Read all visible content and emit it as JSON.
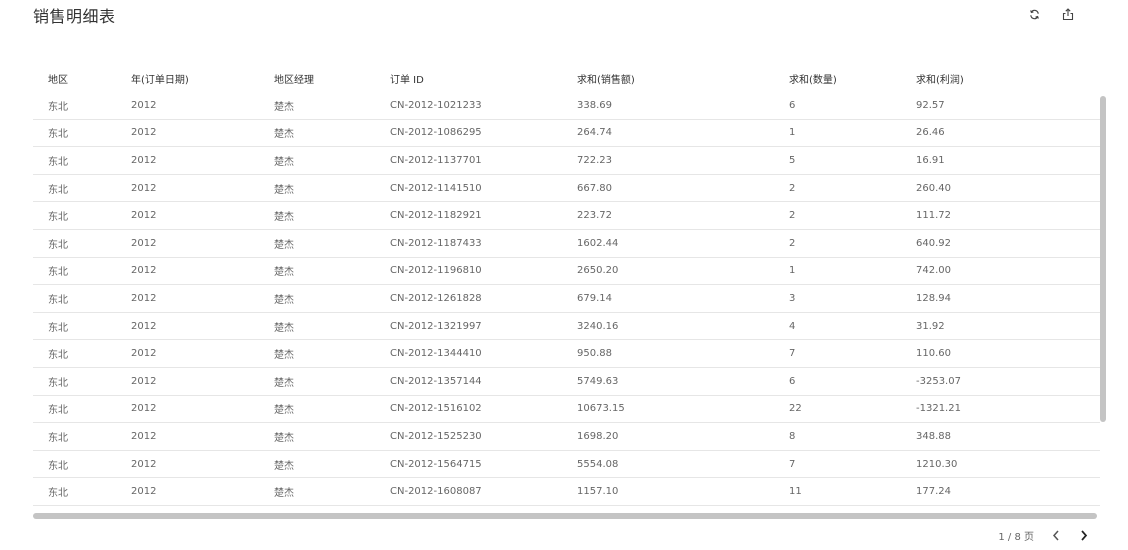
{
  "report": {
    "title": "销售明细表"
  },
  "toolbar": {
    "refresh_icon": "refresh-icon",
    "export_icon": "export-icon"
  },
  "table": {
    "columns": [
      "地区",
      "年(订单日期)",
      "地区经理",
      "订单 ID",
      "求和(销售额)",
      "求和(数量)",
      "求和(利润)"
    ],
    "rows": [
      [
        "东北",
        "2012",
        "楚杰",
        "CN-2012-1021233",
        "338.69",
        "6",
        "92.57"
      ],
      [
        "东北",
        "2012",
        "楚杰",
        "CN-2012-1086295",
        "264.74",
        "1",
        "26.46"
      ],
      [
        "东北",
        "2012",
        "楚杰",
        "CN-2012-1137701",
        "722.23",
        "5",
        "16.91"
      ],
      [
        "东北",
        "2012",
        "楚杰",
        "CN-2012-1141510",
        "667.80",
        "2",
        "260.40"
      ],
      [
        "东北",
        "2012",
        "楚杰",
        "CN-2012-1182921",
        "223.72",
        "2",
        "111.72"
      ],
      [
        "东北",
        "2012",
        "楚杰",
        "CN-2012-1187433",
        "1602.44",
        "2",
        "640.92"
      ],
      [
        "东北",
        "2012",
        "楚杰",
        "CN-2012-1196810",
        "2650.20",
        "1",
        "742.00"
      ],
      [
        "东北",
        "2012",
        "楚杰",
        "CN-2012-1261828",
        "679.14",
        "3",
        "128.94"
      ],
      [
        "东北",
        "2012",
        "楚杰",
        "CN-2012-1321997",
        "3240.16",
        "4",
        "31.92"
      ],
      [
        "东北",
        "2012",
        "楚杰",
        "CN-2012-1344410",
        "950.88",
        "7",
        "110.60"
      ],
      [
        "东北",
        "2012",
        "楚杰",
        "CN-2012-1357144",
        "5749.63",
        "6",
        "-3253.07"
      ],
      [
        "东北",
        "2012",
        "楚杰",
        "CN-2012-1516102",
        "10673.15",
        "22",
        "-1321.21"
      ],
      [
        "东北",
        "2012",
        "楚杰",
        "CN-2012-1525230",
        "1698.20",
        "8",
        "348.88"
      ],
      [
        "东北",
        "2012",
        "楚杰",
        "CN-2012-1564715",
        "5554.08",
        "7",
        "1210.30"
      ],
      [
        "东北",
        "2012",
        "楚杰",
        "CN-2012-1608087",
        "1157.10",
        "11",
        "177.24"
      ]
    ]
  },
  "pagination": {
    "label": "1 / 8 页",
    "prev_icon": "chevron-left-icon",
    "next_icon": "chevron-right-icon"
  },
  "colors": {
    "header_text": "#333333",
    "cell_text": "#666666",
    "row_divider": "#e6e6e6",
    "scrollbar": "#c4c4c4"
  }
}
